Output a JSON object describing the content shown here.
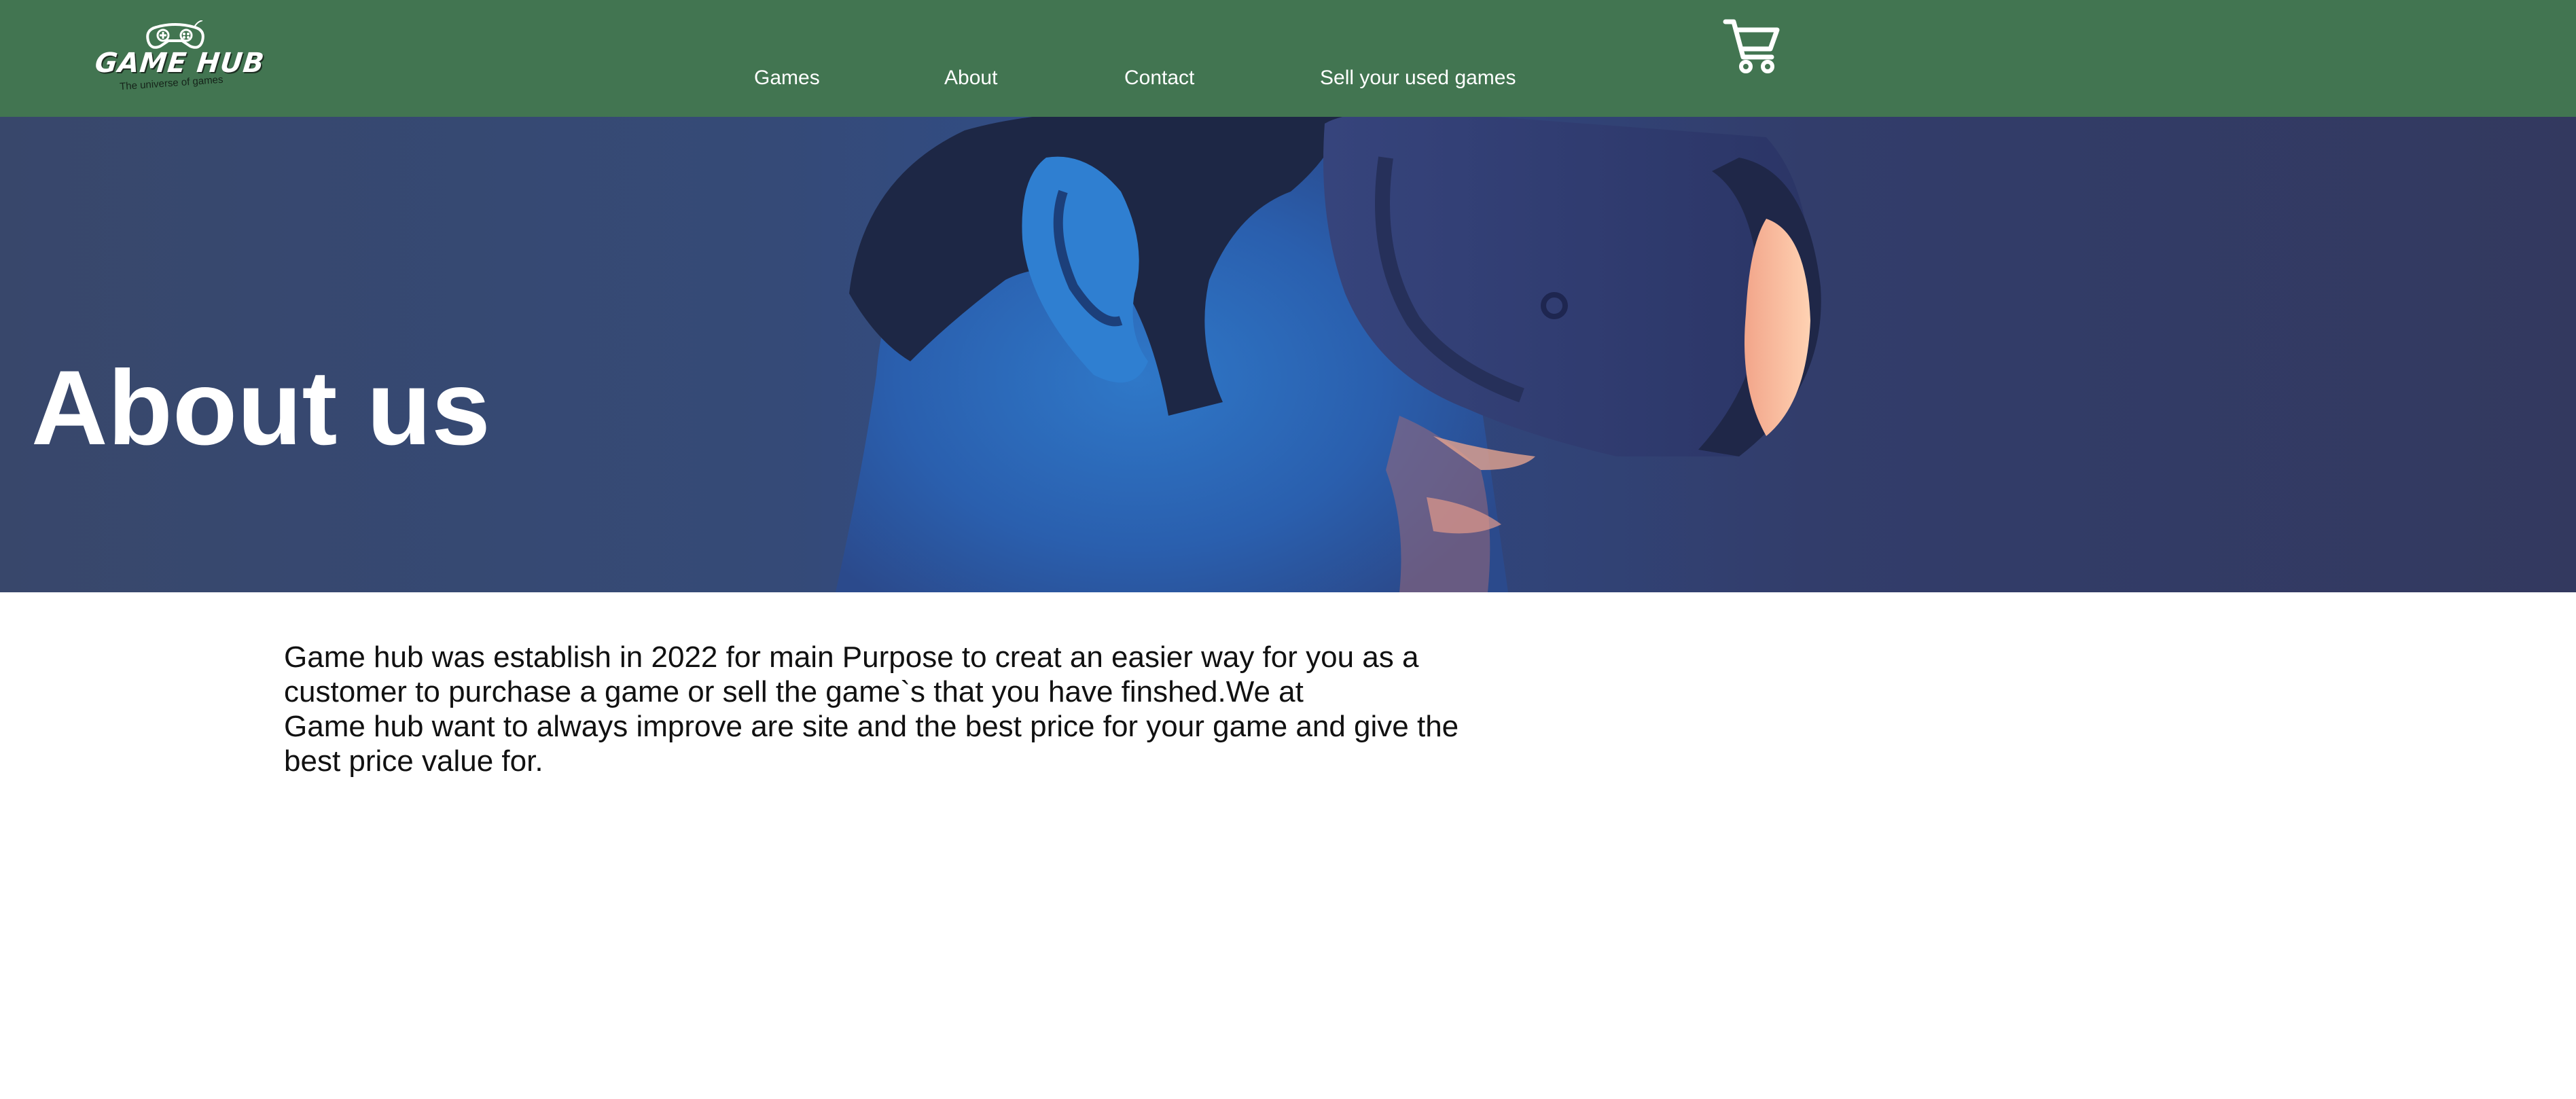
{
  "header": {
    "logo": {
      "title": "GAME HUB",
      "tagline": "The universe of games",
      "icon": "gamepad-icon"
    },
    "nav": [
      {
        "label": "Games"
      },
      {
        "label": "About"
      },
      {
        "label": "Contact"
      },
      {
        "label": "Sell your used games"
      }
    ],
    "cart_icon": "cart-icon"
  },
  "hero": {
    "title": "About us",
    "image": "vr-headset-person-photo"
  },
  "main": {
    "about_text": "Game hub was establish in 2022 for main Purpose to creat an easier way for you as a\ncustomer to purchase a game or sell the game`s that you have finshed.We at\nGame hub want to always improve are site and the best price for your game and give the\nbest price value for."
  },
  "colors": {
    "header_bg": "#427551",
    "hero_bg": "#344a77",
    "text": "#111111",
    "nav_text": "#ffffff"
  }
}
